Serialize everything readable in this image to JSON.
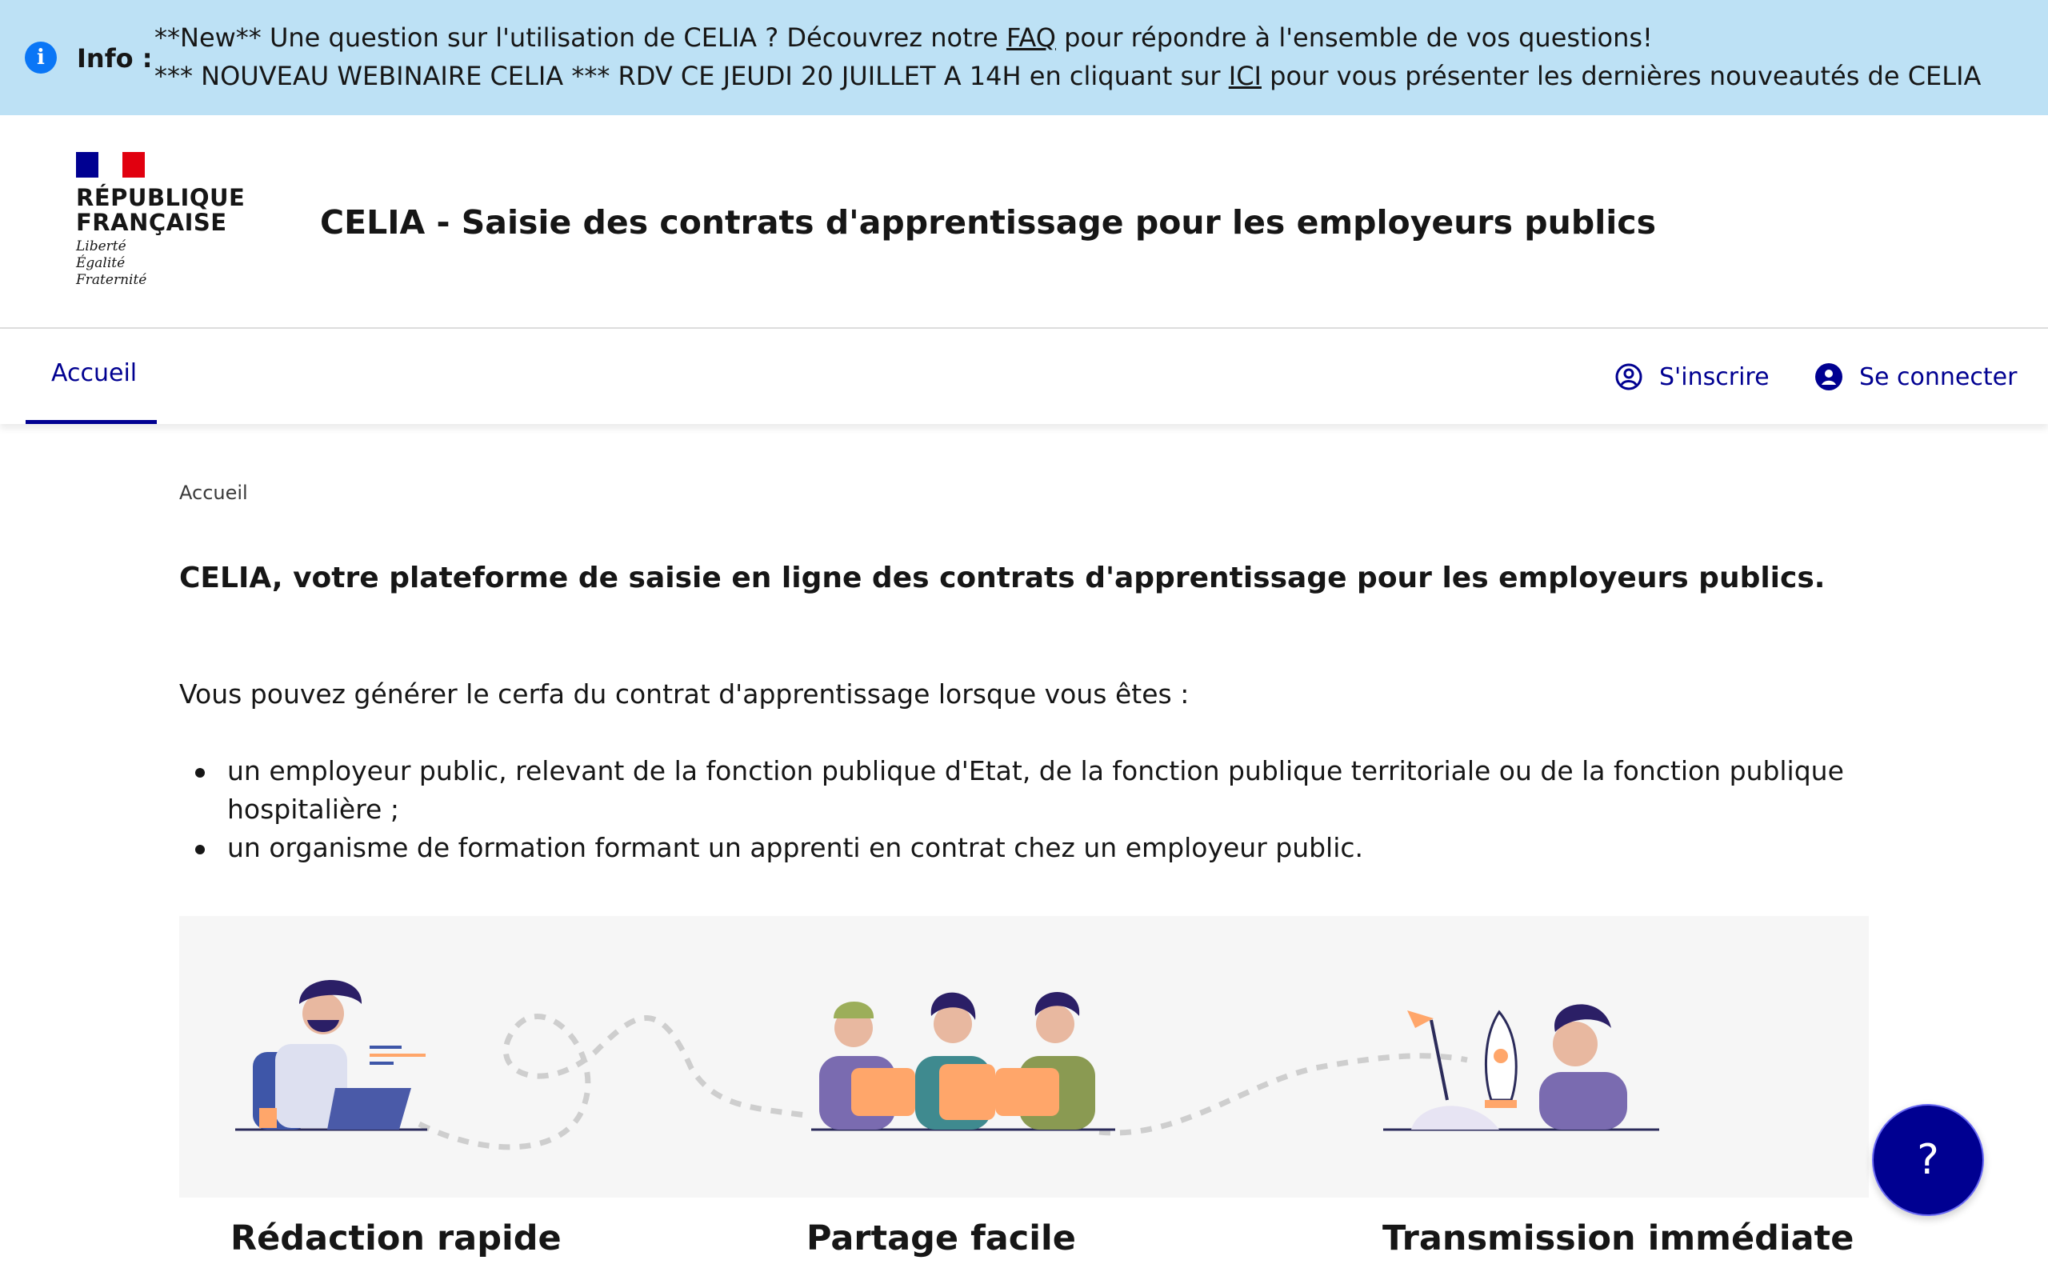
{
  "notice": {
    "label": "Info :",
    "line1_before": "**New** Une question sur l'utilisation de CELIA ? Découvrez notre ",
    "line1_link": "FAQ",
    "line1_after": " pour répondre à l'ensemble de vos questions!",
    "line2_before": "*** NOUVEAU WEBINAIRE CELIA *** RDV CE JEUDI 20 JUILLET A 14H en cliquant sur ",
    "line2_link": "ICI",
    "line2_after": " pour vous présenter les dernières nouveautés de CELIA"
  },
  "header": {
    "logo_line1": "RÉPUBLIQUE",
    "logo_line2": "FRANÇAISE",
    "motto_1": "Liberté",
    "motto_2": "Égalité",
    "motto_3": "Fraternité",
    "site_title": "CELIA - Saisie des contrats d'apprentissage pour les employeurs publics"
  },
  "nav": {
    "home_tab": "Accueil",
    "signup": "S'inscrire",
    "login": "Se connecter"
  },
  "main": {
    "breadcrumb": "Accueil",
    "title": "CELIA, votre plateforme de saisie en ligne des contrats d'apprentissage pour les employeurs publics.",
    "intro": "Vous pouvez générer le cerfa du contrat d'apprentissage lorsque vous êtes :",
    "bullets": [
      "un employeur public, relevant de la fonction publique d'Etat, de la fonction publique territoriale ou de la fonction publique hospitalière ;",
      "un organisme de formation formant un apprenti en contrat chez un employeur public."
    ],
    "features": [
      "Rédaction rapide",
      "Partage facile",
      "Transmission immédiate"
    ]
  },
  "help_button": "?",
  "colors": {
    "banner_bg": "#bde1f5",
    "primary_blue": "#000091",
    "marianne_red": "#e1000f",
    "illustration_orange": "#ffa66a",
    "illustration_purple": "#7a6bb0"
  }
}
